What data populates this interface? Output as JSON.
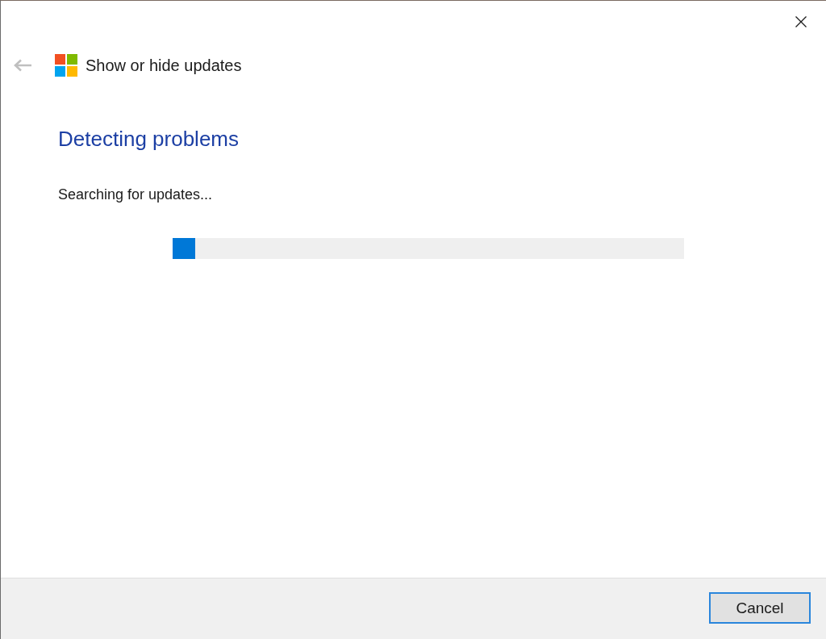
{
  "window": {
    "title": "Show or hide updates",
    "back_button": {
      "disabled": true
    }
  },
  "content": {
    "heading": "Detecting problems",
    "status": "Searching for updates...",
    "progress": {
      "level": 0.044
    }
  },
  "footer": {
    "buttons": [
      {
        "label": "Cancel",
        "default": true
      }
    ]
  }
}
